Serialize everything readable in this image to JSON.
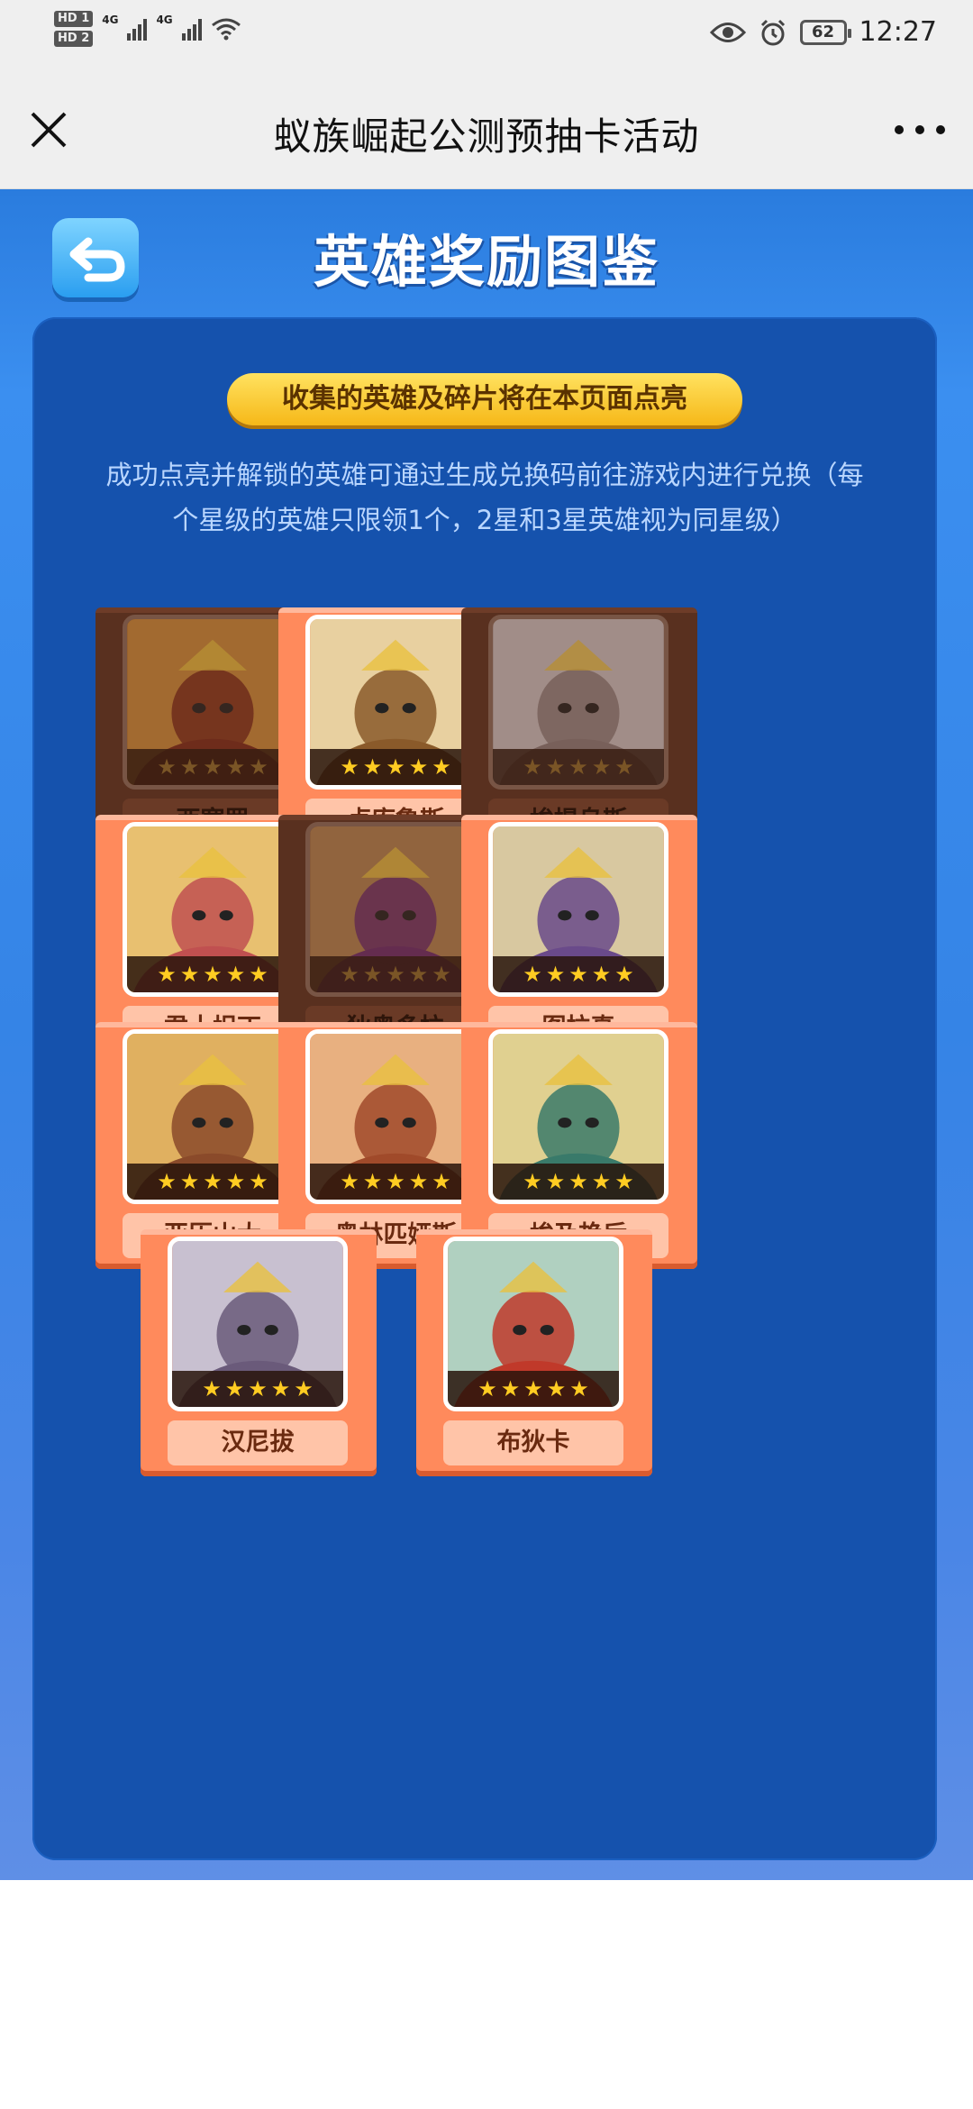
{
  "status_bar": {
    "hd1": "HD 1",
    "hd2": "HD 2",
    "net1": "4G",
    "net2": "4G",
    "battery": "62",
    "time": "12:27"
  },
  "header": {
    "title": "蚁族崛起公测预抽卡活动"
  },
  "event": {
    "title": "英雄奖励图鉴",
    "banner": "收集的英雄及碎片将在本页面点亮",
    "description": "成功点亮并解锁的英雄可通过生成兑换码前往游戏内进行兑换（每个星级的英雄只限领1个，2星和3星英雄视为同星级）"
  },
  "heroes": [
    {
      "name": "西塞罗",
      "lit": false,
      "stars": 5
    },
    {
      "name": "卢库鲁斯",
      "lit": true,
      "stars": 5
    },
    {
      "name": "埃提乌斯",
      "lit": false,
      "stars": 5
    },
    {
      "name": "君士坦丁",
      "lit": true,
      "stars": 5
    },
    {
      "name": "狄奥多拉",
      "lit": false,
      "stars": 5
    },
    {
      "name": "图拉真",
      "lit": true,
      "stars": 5
    },
    {
      "name": "亚历山大",
      "lit": true,
      "stars": 5
    },
    {
      "name": "奥林匹娅斯",
      "lit": true,
      "stars": 5
    },
    {
      "name": "埃及艳后",
      "lit": true,
      "stars": 5
    },
    {
      "name": "汉尼拔",
      "lit": true,
      "stars": 5
    },
    {
      "name": "布狄卡",
      "lit": true,
      "stars": 5
    }
  ],
  "colors": {
    "accent_blue": "#1552ad",
    "lit_card": "#ff8a5c",
    "dim_card": "#59301f",
    "star": "#ffcc22"
  }
}
